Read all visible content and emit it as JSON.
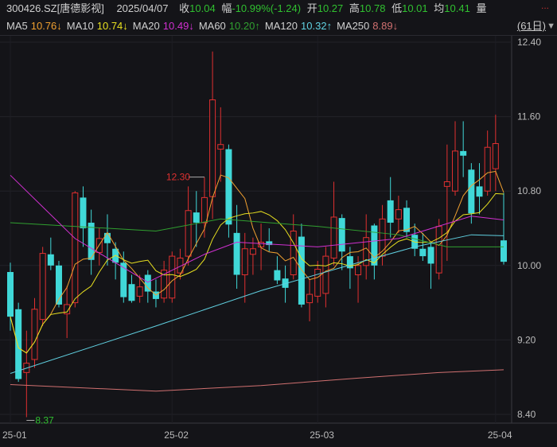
{
  "header": {
    "code": "300426.SZ[唐德影视]",
    "date": "2025/04/07",
    "close_label": "收",
    "close": "10.04",
    "change_label": "幅",
    "change": "-10.99%(-1.24)",
    "open_label": "开",
    "open": "10.27",
    "high_label": "高",
    "high": "10.78",
    "low_label": "低",
    "low": "10.01",
    "avg_label": "均",
    "avg": "10.41",
    "volume_label": "量",
    "more": "..."
  },
  "ma_legend": [
    {
      "name": "MA5",
      "value": "10.76↓",
      "color": "#f0a030"
    },
    {
      "name": "MA10",
      "value": "10.74↓",
      "color": "#e8e020"
    },
    {
      "name": "MA20",
      "value": "10.49↓",
      "color": "#d030d0"
    },
    {
      "name": "MA60",
      "value": "10.20↑",
      "color": "#30a030"
    },
    {
      "name": "MA120",
      "value": "10.32↑",
      "color": "#60d0e0"
    },
    {
      "name": "MA250",
      "value": "8.89↓",
      "color": "#d07070"
    }
  ],
  "period": "(61日)",
  "colors": {
    "up": "#e03030",
    "down": "#40d8d8",
    "text_down": "#30c030",
    "background": "#141418"
  },
  "chart_data": {
    "type": "candlestick",
    "ylim": [
      8.2,
      12.6
    ],
    "y_ticks": [
      "12.40",
      "11.60",
      "10.80",
      "10.00",
      "9.20",
      "8.40"
    ],
    "x_ticks": [
      {
        "label": "25-01",
        "index": 0
      },
      {
        "label": "25-02",
        "index": 20
      },
      {
        "label": "25-03",
        "index": 38
      },
      {
        "label": "25-04",
        "index": 60
      }
    ],
    "annotations": [
      {
        "label": "12.30",
        "index": 24,
        "type": "high"
      },
      {
        "label": "8.37",
        "index": 2,
        "type": "low"
      }
    ],
    "ohlc": [
      [
        9.93,
        10.03,
        9.3,
        9.45
      ],
      [
        9.53,
        9.6,
        8.75,
        8.78
      ],
      [
        8.85,
        9.3,
        8.37,
        8.95
      ],
      [
        8.99,
        9.65,
        8.9,
        9.53
      ],
      [
        9.42,
        10.2,
        9.35,
        10.13
      ],
      [
        10.12,
        10.3,
        9.95,
        10.0
      ],
      [
        10.0,
        10.05,
        9.55,
        9.58
      ],
      [
        9.48,
        9.78,
        9.22,
        9.58
      ],
      [
        9.6,
        10.8,
        9.55,
        10.78
      ],
      [
        10.73,
        10.85,
        10.2,
        10.4
      ],
      [
        10.46,
        10.6,
        9.9,
        10.06
      ],
      [
        10.14,
        10.4,
        10.0,
        10.29
      ],
      [
        10.35,
        10.55,
        10.0,
        10.24
      ],
      [
        10.18,
        10.25,
        9.85,
        10.03
      ],
      [
        10.03,
        10.15,
        9.6,
        9.66
      ],
      [
        9.8,
        9.9,
        9.6,
        9.62
      ],
      [
        9.67,
        9.9,
        9.6,
        9.77
      ],
      [
        9.9,
        9.95,
        9.6,
        9.72
      ],
      [
        9.72,
        9.85,
        9.55,
        9.64
      ],
      [
        9.65,
        10.05,
        9.6,
        9.95
      ],
      [
        9.65,
        10.15,
        9.6,
        10.1
      ],
      [
        9.92,
        10.18,
        9.85,
        10.08
      ],
      [
        10.1,
        10.85,
        10.0,
        10.59
      ],
      [
        10.57,
        10.8,
        10.2,
        10.46
      ],
      [
        10.46,
        10.95,
        10.3,
        10.73
      ],
      [
        10.74,
        12.3,
        10.5,
        11.78
      ],
      [
        11.25,
        11.7,
        10.9,
        11.3
      ],
      [
        11.25,
        11.3,
        10.3,
        10.44
      ],
      [
        10.35,
        10.65,
        9.75,
        9.9
      ],
      [
        9.9,
        10.35,
        9.6,
        10.18
      ],
      [
        10.12,
        10.3,
        9.9,
        10.18
      ],
      [
        10.2,
        10.45,
        9.95,
        10.25
      ],
      [
        10.26,
        10.4,
        10.15,
        10.22
      ],
      [
        9.95,
        10.1,
        9.8,
        9.84
      ],
      [
        9.86,
        10.0,
        9.6,
        9.76
      ],
      [
        9.9,
        10.55,
        9.85,
        10.37
      ],
      [
        10.31,
        10.45,
        9.55,
        9.58
      ],
      [
        9.6,
        9.85,
        9.4,
        9.69
      ],
      [
        9.67,
        10.05,
        9.6,
        9.96
      ],
      [
        9.7,
        10.2,
        9.55,
        10.1
      ],
      [
        10.08,
        10.9,
        10.0,
        10.52
      ],
      [
        10.51,
        10.55,
        9.95,
        10.15
      ],
      [
        10.1,
        10.2,
        9.75,
        9.97
      ],
      [
        9.9,
        10.1,
        9.6,
        10.0
      ],
      [
        10.0,
        10.55,
        9.85,
        10.3
      ],
      [
        10.43,
        10.45,
        9.85,
        10.0
      ],
      [
        10.1,
        10.65,
        10.0,
        10.5
      ],
      [
        10.7,
        10.95,
        10.3,
        10.46
      ],
      [
        10.5,
        10.75,
        10.35,
        10.6
      ],
      [
        10.62,
        10.7,
        10.3,
        10.36
      ],
      [
        10.33,
        10.45,
        10.1,
        10.18
      ],
      [
        10.18,
        10.35,
        10.05,
        10.1
      ],
      [
        10.2,
        10.25,
        9.75,
        10.02
      ],
      [
        9.92,
        10.5,
        9.85,
        10.42
      ],
      [
        10.85,
        11.3,
        10.05,
        10.9
      ],
      [
        10.8,
        11.55,
        10.75,
        11.23
      ],
      [
        11.23,
        11.55,
        10.95,
        11.18
      ],
      [
        11.03,
        11.1,
        10.45,
        10.56
      ],
      [
        10.85,
        11.1,
        10.55,
        10.74
      ],
      [
        10.8,
        11.45,
        10.75,
        11.27
      ],
      [
        11.04,
        11.62,
        10.8,
        11.31
      ],
      [
        10.27,
        10.78,
        10.01,
        10.04
      ]
    ],
    "ma_lines": [
      {
        "name": "MA60",
        "color": "#30a030",
        "points": [
          [
            0,
            10.46
          ],
          [
            18,
            10.37
          ],
          [
            26,
            10.5
          ],
          [
            38,
            10.42
          ],
          [
            48,
            10.33
          ],
          [
            54,
            10.2
          ],
          [
            61,
            10.2
          ]
        ]
      },
      {
        "name": "MA120",
        "color": "#60d0e0",
        "points": [
          [
            0,
            8.84
          ],
          [
            18,
            9.35
          ],
          [
            31,
            9.73
          ],
          [
            43,
            10.03
          ],
          [
            50,
            10.2
          ],
          [
            57,
            10.33
          ],
          [
            61,
            10.32
          ]
        ]
      },
      {
        "name": "MA250",
        "color": "#d07070",
        "points": [
          [
            0,
            8.72
          ],
          [
            18,
            8.65
          ],
          [
            31,
            8.71
          ],
          [
            43,
            8.79
          ],
          [
            53,
            8.85
          ],
          [
            61,
            8.88
          ]
        ]
      },
      {
        "name": "MA20",
        "color": "#d030d0",
        "points": [
          [
            0,
            10.97
          ],
          [
            8,
            10.29
          ],
          [
            17,
            9.82
          ],
          [
            24,
            10.12
          ],
          [
            28,
            10.25
          ],
          [
            38,
            10.2
          ],
          [
            48,
            10.29
          ],
          [
            57,
            10.53
          ],
          [
            61,
            10.49
          ]
        ]
      }
    ]
  }
}
